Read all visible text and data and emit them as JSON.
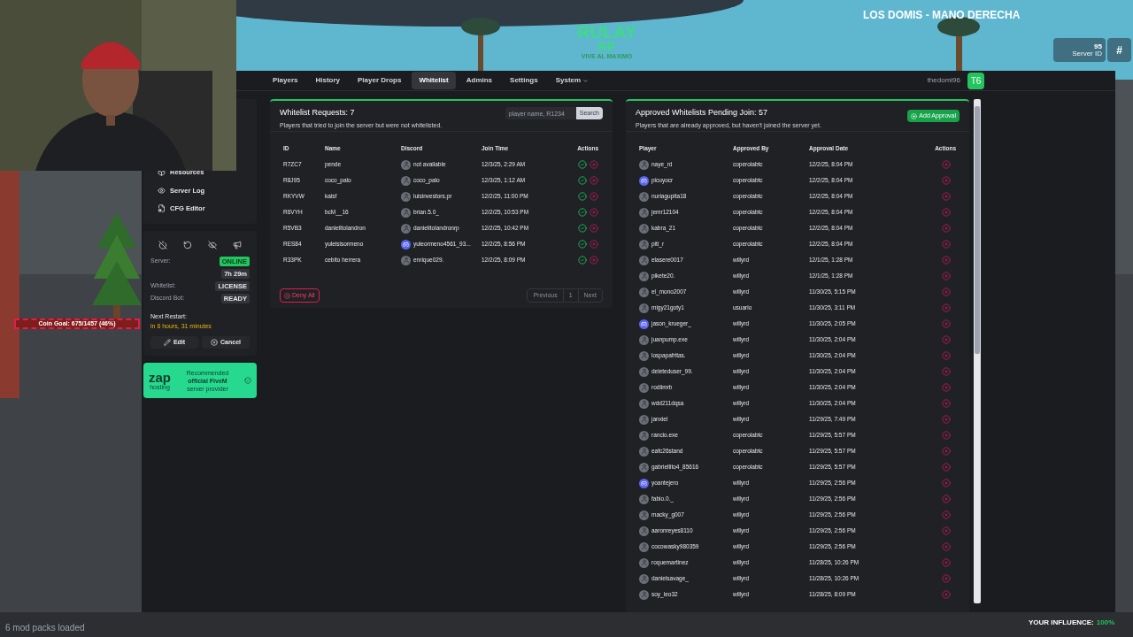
{
  "stream_overlay": {
    "channel_title": "LOS DOMIS - MANO DERECHA",
    "logo": {
      "title": "RULAY",
      "title_2": "RP",
      "tagline": "VIVE AL MAXIMO"
    },
    "server_id": {
      "value": "95",
      "label": "Server ID",
      "button": "#"
    },
    "coin_goal": "Coin Goal: 675/1457 (46%)",
    "mods_status": "6 mod packs loaded",
    "influence": {
      "label": "YOUR INFLUENCE:",
      "value": "100%"
    }
  },
  "nav": {
    "tabs": [
      {
        "label": "Players",
        "selected": false,
        "dropdown": false
      },
      {
        "label": "History",
        "selected": false,
        "dropdown": false
      },
      {
        "label": "Player Drops",
        "selected": false,
        "dropdown": false
      },
      {
        "label": "Whitelist",
        "selected": true,
        "dropdown": false
      },
      {
        "label": "Admins",
        "selected": false,
        "dropdown": false
      },
      {
        "label": "Settings",
        "selected": false,
        "dropdown": false
      },
      {
        "label": "System",
        "selected": false,
        "dropdown": true
      }
    ],
    "user": {
      "name": "thedomi96",
      "badge": "T6"
    }
  },
  "sidebar": {
    "items": [
      {
        "label": "Resources",
        "kind": "box"
      },
      {
        "label": "Server Log",
        "kind": "eye"
      },
      {
        "label": "CFG Editor",
        "kind": "file"
      }
    ],
    "status": [
      {
        "label": "Server:",
        "value": "ONLINE",
        "kind": "success"
      },
      {
        "value": "7h 29m",
        "kind": "neutral"
      },
      {
        "label": "Whitelist:",
        "value": "LICENSE",
        "kind": "neutral"
      },
      {
        "label": "Discord Bot:",
        "value": "READY",
        "kind": "neutral"
      }
    ],
    "next_restart": {
      "label": "Next Restart:",
      "value": "in 6 hours, 31 minutes"
    },
    "buttons": [
      {
        "label": "Edit",
        "kind": "edit"
      },
      {
        "label": "Cancel",
        "kind": "cancel"
      }
    ],
    "sponsor": {
      "logo": "zap",
      "logo_sub": "hosting",
      "lines": [
        "Recommended",
        "official FiveM",
        "server provider"
      ]
    }
  },
  "whitelist_requests": {
    "title": "Whitelist Requests: 7",
    "subtitle": "Players that tried to join the server but were not whitelisted.",
    "search": {
      "placeholder": "player name, R1234",
      "button": "Search"
    },
    "columns": [
      "ID",
      "Name",
      "Discord",
      "Join Time",
      "Actions"
    ],
    "rows": [
      {
        "id": "R7ZC7",
        "name": "pende",
        "discord": "not available",
        "join_time": "12/3/25, 2:29 AM"
      },
      {
        "id": "R8J95",
        "name": "coco_palo",
        "discord": "coco_palo",
        "join_time": "12/3/25, 1:12 AM"
      },
      {
        "id": "RKYVW",
        "name": "kaisf",
        "discord": "luisinvestors.pr",
        "join_time": "12/2/25, 11:00 PM"
      },
      {
        "id": "R6VYH",
        "name": "bcM__16",
        "discord": "brian.5.0_",
        "join_time": "12/2/25, 10:53 PM"
      },
      {
        "id": "R5VB3",
        "name": "danielitolandron",
        "discord": "danielitolandronrp",
        "join_time": "12/2/25, 10:42 PM"
      },
      {
        "id": "RES84",
        "name": "yuleisisormeno",
        "discord": "yuleormeno4561_93...",
        "avatar": {
          "kind": "discord"
        },
        "join_time": "12/2/25, 8:56 PM"
      },
      {
        "id": "R33PK",
        "name": "cebito herrera",
        "discord": "enrique029.",
        "join_time": "12/2/25, 8:09 PM"
      }
    ],
    "deny_all": "Deny All",
    "pagination": {
      "disabled": true,
      "previous": "Previous",
      "page": "1",
      "next": "Next"
    }
  },
  "approved": {
    "title": "Approved Whitelists Pending Join: 57",
    "subtitle": "Players that are already approved, but haven't joined the server yet.",
    "add_button": "Add Approval",
    "columns": [
      "Player",
      "Approved By",
      "Approval Date",
      "Actions"
    ],
    "rows": [
      {
        "player": "naye_rd",
        "approved_by": "coperolabtc",
        "date": "12/2/25, 8:04 PM"
      },
      {
        "player": "picuyocr",
        "avatar": {
          "kind": "discord"
        },
        "approved_by": "coperolabtc",
        "date": "12/2/25, 8:04 PM"
      },
      {
        "player": "nuriagupita18",
        "approved_by": "coperolabtc",
        "date": "12/2/25, 8:04 PM"
      },
      {
        "player": "jemr12104",
        "approved_by": "coperolabtc",
        "date": "12/2/25, 8:04 PM"
      },
      {
        "player": "kabra_21",
        "approved_by": "coperolabtc",
        "date": "12/2/25, 8:04 PM"
      },
      {
        "player": "piti_r",
        "approved_by": "coperolabtc",
        "date": "12/2/25, 8:04 PM"
      },
      {
        "player": "elasere0017",
        "approved_by": "willyrd",
        "date": "12/1/25, 1:28 PM"
      },
      {
        "player": "pikete20.",
        "approved_by": "willyrd",
        "date": "12/1/25, 1:28 PM"
      },
      {
        "player": "el_mono2007",
        "approved_by": "willyrd",
        "date": "11/30/25, 5:15 PM"
      },
      {
        "player": "migy21goty1",
        "approved_by": "usuario",
        "date": "11/30/25, 3:11 PM"
      },
      {
        "player": "jason_krueger_",
        "avatar": {
          "kind": "discord"
        },
        "approved_by": "willyrd",
        "date": "11/30/25, 2:05 PM"
      },
      {
        "player": "juanpump.exe",
        "approved_by": "willyrd",
        "date": "11/30/25, 2:04 PM"
      },
      {
        "player": "lospapafritas.",
        "approved_by": "willyrd",
        "date": "11/30/25, 2:04 PM"
      },
      {
        "player": "deleteduser_99.",
        "approved_by": "willyrd",
        "date": "11/30/25, 2:04 PM"
      },
      {
        "player": "rodiimrb",
        "approved_by": "willyrd",
        "date": "11/30/25, 2:04 PM"
      },
      {
        "player": "wdd211dqsa",
        "approved_by": "willyrd",
        "date": "11/30/25, 2:04 PM"
      },
      {
        "player": "janxiel",
        "approved_by": "willyrd",
        "date": "11/29/25, 7:49 PM"
      },
      {
        "player": "rancio.exe",
        "approved_by": "coperolabtc",
        "date": "11/29/25, 5:57 PM"
      },
      {
        "player": "eafc26stand",
        "approved_by": "coperolabtc",
        "date": "11/29/25, 5:57 PM"
      },
      {
        "player": "gabriellito4_85616",
        "approved_by": "coperolabtc",
        "date": "11/29/25, 5:57 PM"
      },
      {
        "player": "yoantejero",
        "avatar": {
          "kind": "discord"
        },
        "approved_by": "willyrd",
        "date": "11/29/25, 2:56 PM"
      },
      {
        "player": "fabio.0._",
        "approved_by": "willyrd",
        "date": "11/29/25, 2:56 PM"
      },
      {
        "player": "macky_g007",
        "approved_by": "willyrd",
        "date": "11/29/25, 2:56 PM"
      },
      {
        "player": "aaronreyes8110",
        "approved_by": "willyrd",
        "date": "11/29/25, 2:56 PM"
      },
      {
        "player": "cocowasky980359",
        "approved_by": "willyrd",
        "date": "11/29/25, 2:56 PM"
      },
      {
        "player": "roquemartinez",
        "approved_by": "willyrd",
        "date": "11/28/25, 10:26 PM"
      },
      {
        "player": "danielsavage_",
        "approved_by": "willyrd",
        "date": "11/28/25, 10:26 PM"
      },
      {
        "player": "soy_leo32",
        "approved_by": "willyrd",
        "date": "11/28/25, 8:09 PM"
      }
    ]
  }
}
